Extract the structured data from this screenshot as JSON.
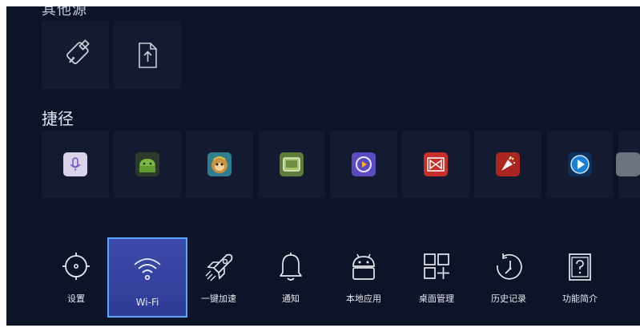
{
  "sources": {
    "title": "其他源",
    "items": [
      {
        "name": "usb-drive",
        "label": ""
      },
      {
        "name": "file-upload",
        "label": ""
      }
    ]
  },
  "shortcuts": {
    "title": "捷径",
    "items": [
      {
        "icon": "microphone-icon",
        "color": "#d9d4ea"
      },
      {
        "icon": "android-icon",
        "color": "#4f7d3a"
      },
      {
        "icon": "monkey-king-icon",
        "color": "#3b8a9a"
      },
      {
        "icon": "screen-app-icon",
        "color": "#4d6a3c"
      },
      {
        "icon": "video-player-icon",
        "color": "#6a59c8"
      },
      {
        "icon": "bowtie-app-icon",
        "color": "#c8302b"
      },
      {
        "icon": "celebration-app-icon",
        "color": "#b02a2a"
      },
      {
        "icon": "play-button-icon",
        "color": "#1c79c9"
      }
    ]
  },
  "dock": {
    "items": [
      {
        "label": "设置",
        "icon": "settings-gear-icon"
      },
      {
        "label": "Wi-Fi",
        "icon": "wifi-icon",
        "active": true
      },
      {
        "label": "一键加速",
        "icon": "rocket-icon"
      },
      {
        "label": "通知",
        "icon": "bell-icon"
      },
      {
        "label": "本地应用",
        "icon": "local-apps-android-icon"
      },
      {
        "label": "桌面管理",
        "icon": "desktop-grid-icon"
      },
      {
        "label": "历史记录",
        "icon": "history-clock-icon"
      },
      {
        "label": "功能简介",
        "icon": "help-book-icon"
      }
    ]
  },
  "colors": {
    "background": "#0e1428",
    "tile": "#141b31",
    "active_bg": "#3542a0",
    "active_border": "#5aa6ff"
  }
}
